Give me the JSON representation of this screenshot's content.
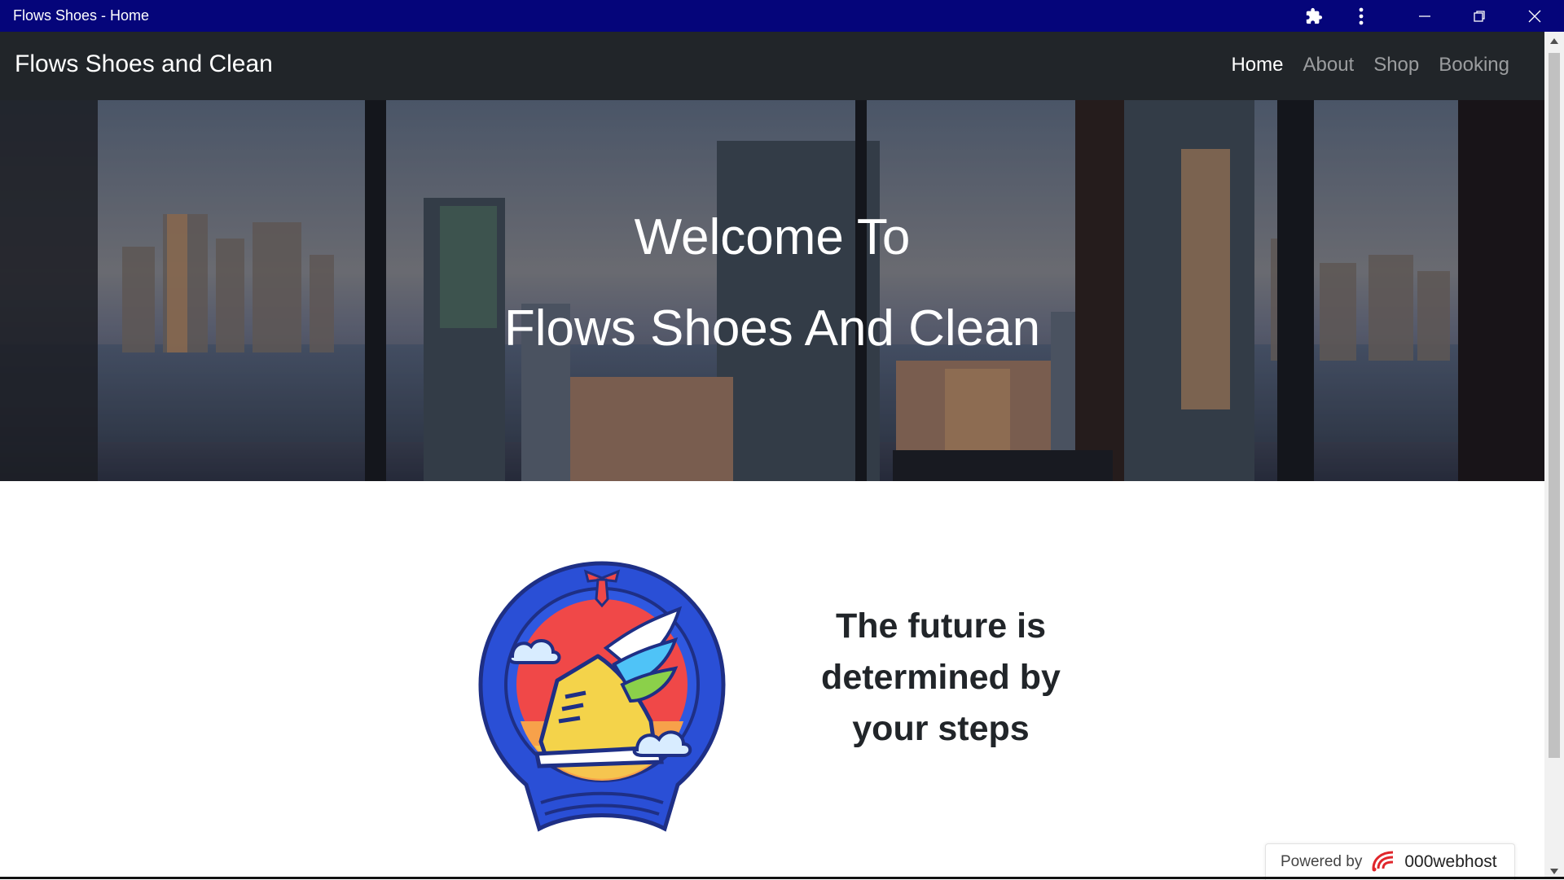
{
  "window": {
    "title": "Flows Shoes - Home",
    "icons": [
      "puzzle-icon",
      "more-vertical-icon",
      "minimize-icon",
      "restore-icon",
      "close-icon"
    ]
  },
  "navbar": {
    "brand": "Flows Shoes and Clean",
    "links": [
      {
        "label": "Home",
        "active": true
      },
      {
        "label": "About",
        "active": false
      },
      {
        "label": "Shop",
        "active": false
      },
      {
        "label": "Booking",
        "active": false
      }
    ]
  },
  "hero": {
    "line1": "Welcome To",
    "line2": "Flows Shoes And Clean"
  },
  "feature": {
    "tagline": "The future is determined by your steps",
    "logo_icon": "winged-shoe-badge-icon"
  },
  "badge": {
    "powered": "Powered by",
    "host": "000webhost"
  },
  "colors": {
    "titlebar": "#05057a",
    "navbar": "#212529",
    "logo_blue": "#2a4fd6",
    "logo_red": "#f04848"
  }
}
